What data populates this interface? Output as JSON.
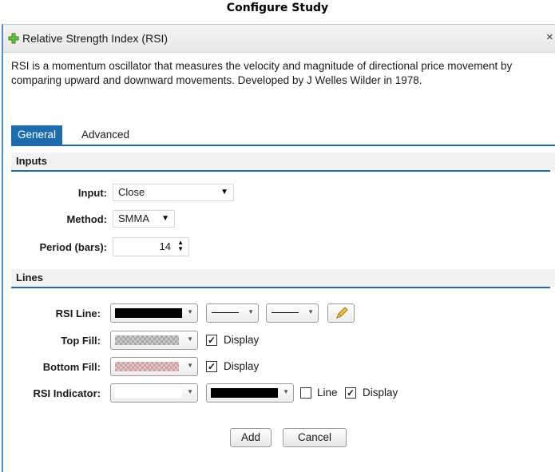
{
  "page": {
    "caption": "Configure Study"
  },
  "dialog": {
    "title": "Relative Strength Index (RSI)",
    "close_glyph": "×",
    "description": "RSI is a momentum oscillator that measures the velocity and magnitude of directional price movement by comparing upward and downward movements. Developed by J Welles Wilder in 1978."
  },
  "tabs": [
    {
      "label": "General",
      "active": true
    },
    {
      "label": "Advanced",
      "active": false
    }
  ],
  "inputs": {
    "heading": "Inputs",
    "input_label": "Input:",
    "input_value": "Close",
    "method_label": "Method:",
    "method_value": "SMMA",
    "period_label": "Period (bars):",
    "period_value": "14"
  },
  "lines": {
    "heading": "Lines",
    "rsi_line_label": "RSI Line:",
    "rsi_line_color": "#000000",
    "top_fill_label": "Top Fill:",
    "top_fill_checked": true,
    "bottom_fill_label": "Bottom Fill:",
    "bottom_fill_checked": true,
    "display_label": "Display",
    "rsi_indicator_label": "RSI Indicator:",
    "rsi_indicator_color1": "#ffffff",
    "rsi_indicator_color2": "#000000",
    "line_label": "Line",
    "line_checked": false,
    "display_checked": true
  },
  "buttons": {
    "add": "Add",
    "cancel": "Cancel"
  },
  "icons": {
    "title": "plus-icon",
    "edit": "pencil-icon",
    "dropdown": "chevron-down-icon"
  },
  "colors": {
    "accent": "#1d6cb0",
    "icon_green": "#6bbf3a"
  }
}
